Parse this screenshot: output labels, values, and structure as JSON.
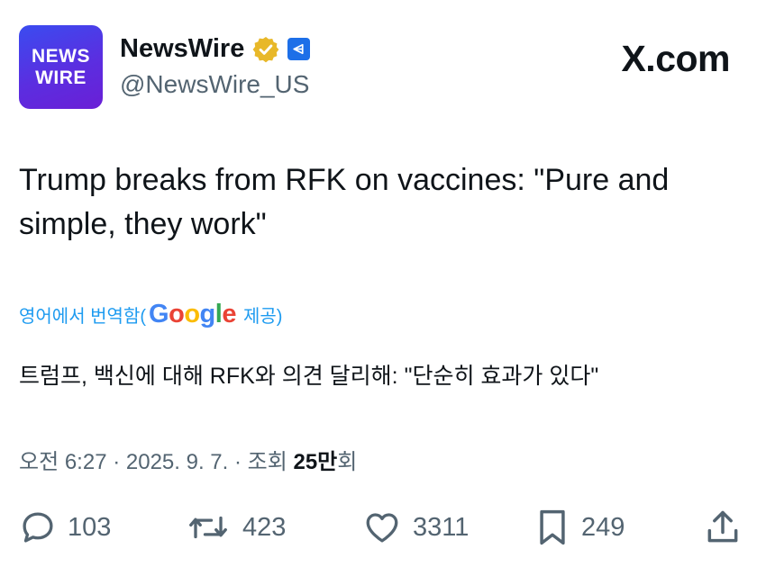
{
  "avatar": {
    "line1": "NEWS",
    "line2": "WIRE"
  },
  "account": {
    "display_name": "NewsWire",
    "handle": "@NewsWire_US",
    "verified_icon": "verified-gold-badge",
    "affiliate_icon": "affiliate-badge"
  },
  "brand": {
    "label": "X.com"
  },
  "post": {
    "text": "Trump breaks from RFK on vaccines: \"Pure and simple, they work\""
  },
  "translation": {
    "prefix": "영어에서 번역함(",
    "google_logo": [
      "G",
      "o",
      "o",
      "g",
      "l",
      "e"
    ],
    "suffix": "제공)",
    "text": "트럼프, 백신에 대해 RFK와 의견 달리해: \"단순히 효과가 있다\""
  },
  "meta": {
    "time": "오전 6:27",
    "separator": " · ",
    "date": "2025. 9. 7.",
    "views_label": "조회",
    "views_count": "25만",
    "views_suffix": "회"
  },
  "actions": {
    "replies": {
      "icon": "reply-icon",
      "count": "103"
    },
    "reposts": {
      "icon": "repost-icon",
      "count": "423"
    },
    "likes": {
      "icon": "like-icon",
      "count": "3311"
    },
    "bookmarks": {
      "icon": "bookmark-icon",
      "count": "249"
    },
    "share": {
      "icon": "share-icon"
    }
  },
  "colors": {
    "text_primary": "#0f1419",
    "text_secondary": "#536471",
    "link": "#1d9bf0",
    "verified_gold": "#e8b829",
    "affiliate_blue": "#1d6fe8"
  }
}
